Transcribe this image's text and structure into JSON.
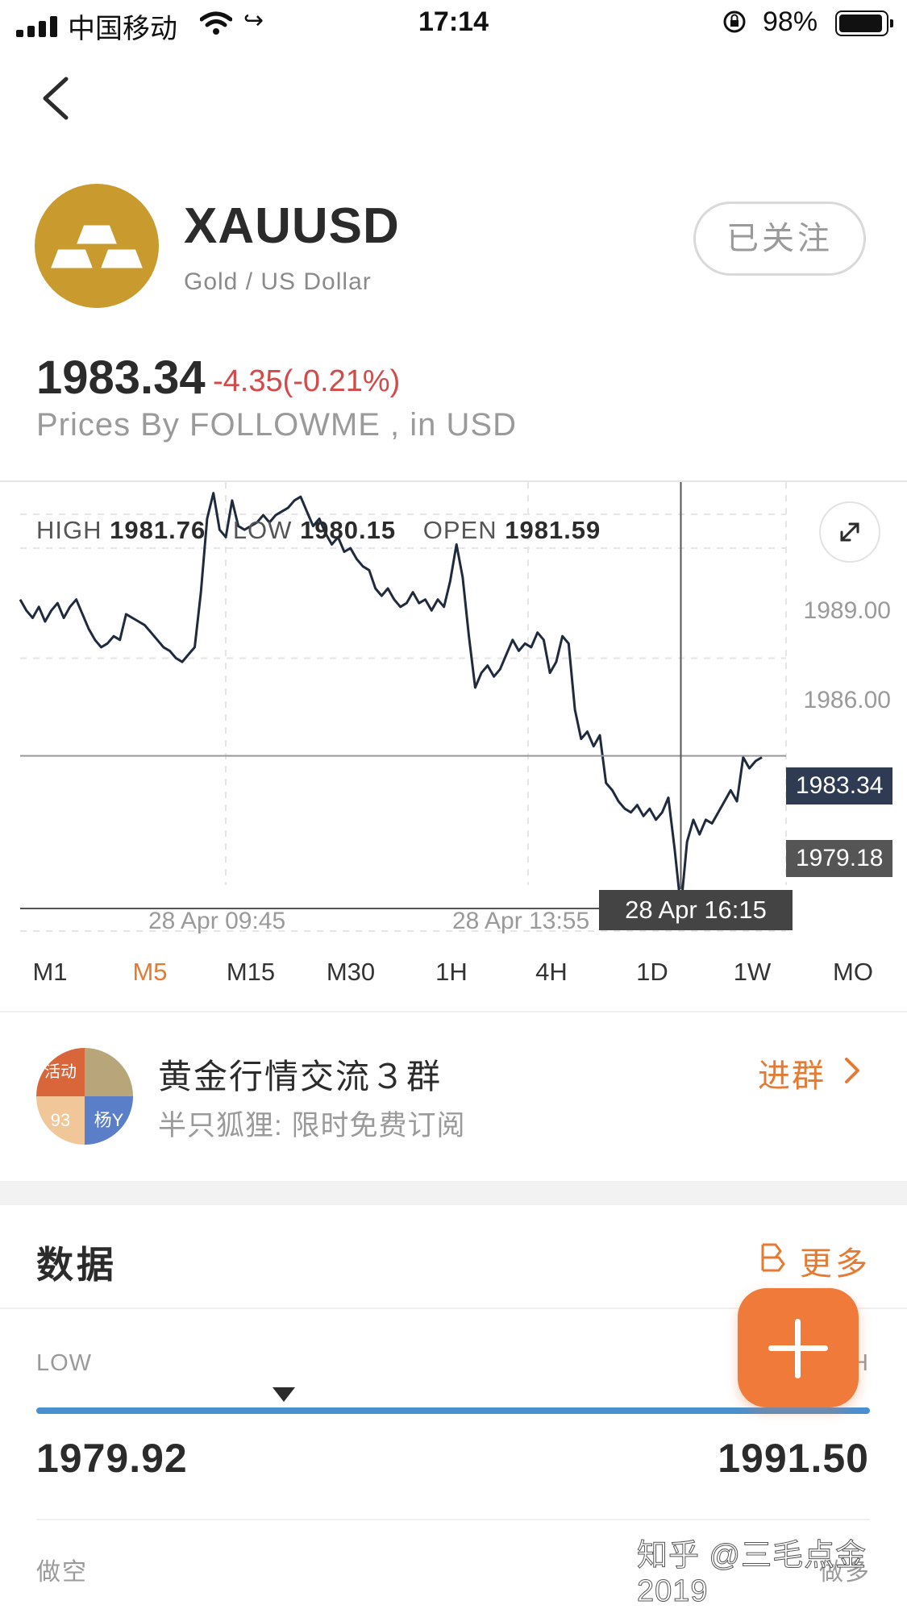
{
  "status_bar": {
    "carrier": "中国移动",
    "time": "17:14",
    "battery_percent": "98%",
    "battery_level": 0.98
  },
  "instrument": {
    "symbol": "XAUUSD",
    "full_name": "Gold / US Dollar",
    "follow_label": "已关注",
    "price": "1983.34",
    "change": "-4.35(-0.21%)",
    "source": "Prices By FOLLOWME , in USD",
    "brand_color": "#c99a2e"
  },
  "ohlc": {
    "high_label": "HIGH",
    "high": "1981.76",
    "low_label": "LOW",
    "low": "1980.15",
    "open_label": "OPEN",
    "open": "1981.59"
  },
  "chart": {
    "y_labels": [
      "1989.00",
      "1986.00"
    ],
    "current_price_tag": "1983.34",
    "crosshair_price_tag": "1979.18",
    "crosshair_date": "28 Apr 16:15",
    "x_labels": [
      "28 Apr 09:45",
      "28 Apr 13:55"
    ]
  },
  "chart_data": {
    "type": "line",
    "title": "",
    "xlabel": "",
    "ylabel": "",
    "ylim": [
      1978.5,
      1990.8
    ],
    "x_ticks": [
      "28 Apr 09:45",
      "28 Apr 13:55"
    ],
    "y_ticks": [
      1989.0,
      1986.0
    ],
    "values": [
      1987.6,
      1987.3,
      1987.1,
      1987.4,
      1987.0,
      1987.3,
      1987.5,
      1987.1,
      1987.4,
      1987.6,
      1987.2,
      1986.8,
      1986.5,
      1986.3,
      1986.4,
      1986.6,
      1986.5,
      1987.2,
      1987.1,
      1987.0,
      1986.9,
      1986.7,
      1986.5,
      1986.3,
      1986.2,
      1986.0,
      1985.9,
      1986.1,
      1986.3,
      1987.8,
      1989.8,
      1990.5,
      1989.5,
      1989.3,
      1990.3,
      1989.6,
      1989.5,
      1989.6,
      1989.7,
      1989.9,
      1989.7,
      1989.9,
      1990.0,
      1990.1,
      1990.3,
      1990.4,
      1990.0,
      1989.6,
      1989.8,
      1989.4,
      1989.1,
      1989.3,
      1988.9,
      1989.0,
      1988.7,
      1988.5,
      1988.4,
      1987.9,
      1987.7,
      1987.9,
      1987.6,
      1987.4,
      1987.5,
      1987.8,
      1987.5,
      1987.6,
      1987.3,
      1987.6,
      1987.4,
      1988.1,
      1989.1,
      1988.2,
      1986.6,
      1985.2,
      1985.6,
      1985.8,
      1985.5,
      1985.7,
      1986.1,
      1986.5,
      1986.2,
      1986.4,
      1986.3,
      1986.7,
      1986.5,
      1985.6,
      1985.9,
      1986.6,
      1986.4,
      1984.6,
      1983.8,
      1984.0,
      1983.6,
      1983.9,
      1982.6,
      1982.4,
      1982.1,
      1981.9,
      1981.8,
      1982.0,
      1981.7,
      1981.9,
      1981.6,
      1981.8,
      1982.2,
      1980.8,
      1979.2,
      1981.0,
      1981.6,
      1981.2,
      1981.6,
      1981.5,
      1981.8,
      1982.1,
      1982.4,
      1982.1,
      1983.3,
      1983.0,
      1983.2,
      1983.3
    ],
    "current_price": 1983.34,
    "crosshair_price": 1979.18,
    "crosshair_label": "28 Apr 16:15",
    "grid": true
  },
  "timeframes": [
    "M1",
    "M5",
    "M15",
    "M30",
    "1H",
    "4H",
    "1D",
    "1W",
    "MO"
  ],
  "active_timeframe": "M5",
  "group": {
    "avatar_labels": [
      "活动",
      "93",
      "杨Y"
    ],
    "name": "黄金行情交流３群",
    "subtitle": "半只狐狸: 限时免费订阅",
    "join_label": "进群"
  },
  "data_section": {
    "title": "数据",
    "more_label": "更多",
    "low_label": "LOW",
    "high_label": "H",
    "low_value": "1979.92",
    "high_value": "1991.50",
    "short_label": "做空",
    "long_label": "做多"
  },
  "watermark": "知乎 @三毛点金2019",
  "accent_color": "#e57a33",
  "down_color": "#d24a4a"
}
